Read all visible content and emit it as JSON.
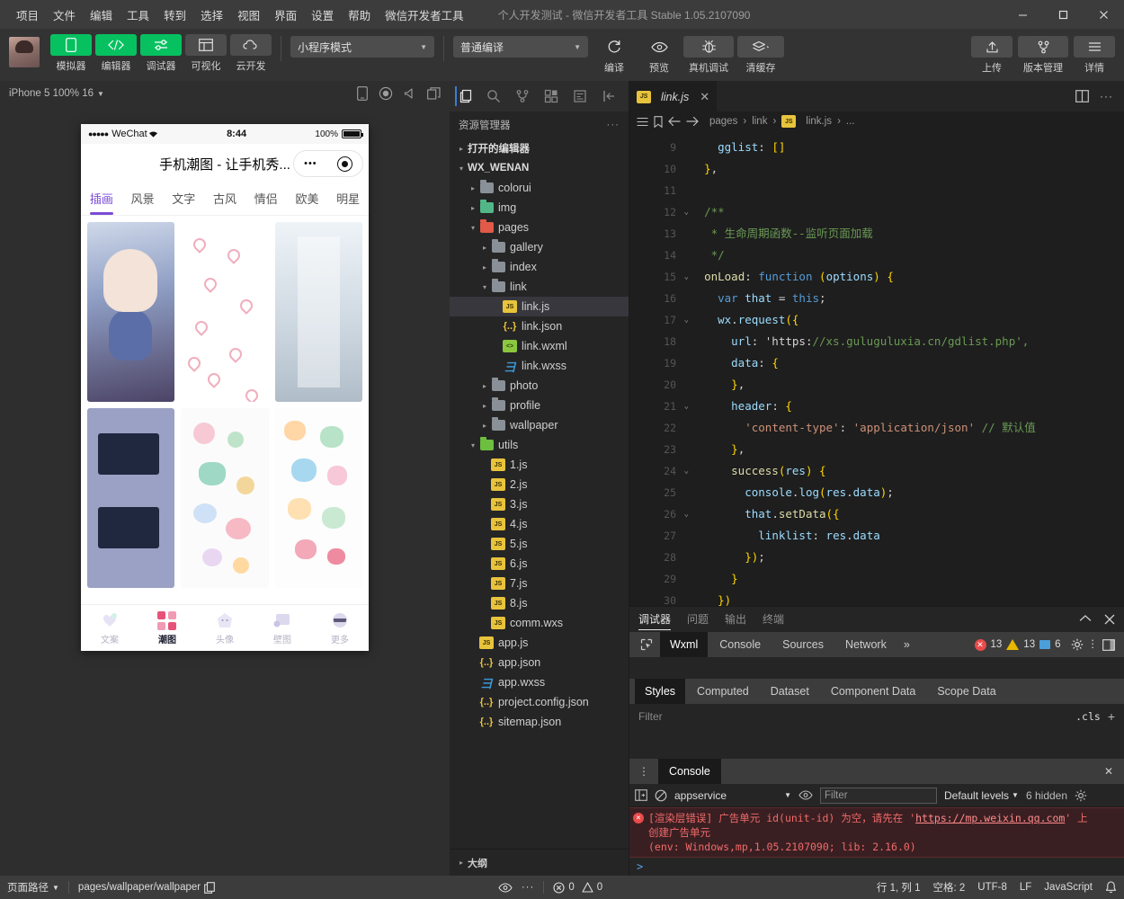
{
  "window": {
    "menus": [
      "项目",
      "文件",
      "编辑",
      "工具",
      "转到",
      "选择",
      "视图",
      "界面",
      "设置",
      "帮助",
      "微信开发者工具"
    ],
    "title": "个人开发测试 - 微信开发者工具 Stable 1.05.2107090",
    "minimize": "—",
    "maximize": "▢",
    "close": "✕"
  },
  "toolbar": {
    "left_buttons": [
      {
        "label": "模拟器",
        "icon": "phone-icon",
        "state": "active"
      },
      {
        "label": "编辑器",
        "icon": "code-icon",
        "state": "active"
      },
      {
        "label": "调试器",
        "icon": "debug-icon",
        "state": "active"
      },
      {
        "label": "可视化",
        "icon": "layout-icon",
        "state": "inactive"
      },
      {
        "label": "云开发",
        "icon": "cloud-icon",
        "state": "inactive"
      }
    ],
    "mode_select": "小程序模式",
    "compile_select": "普通编译",
    "actions": [
      {
        "label": "编译",
        "icon": "refresh-icon"
      },
      {
        "label": "预览",
        "icon": "eye-icon"
      },
      {
        "label": "真机调试",
        "icon": "bug-icon"
      },
      {
        "label": "清缓存",
        "icon": "layers-icon"
      }
    ],
    "right_actions": [
      {
        "label": "上传",
        "icon": "upload-icon"
      },
      {
        "label": "版本管理",
        "icon": "git-branch-icon"
      },
      {
        "label": "详情",
        "icon": "hamburger-icon"
      }
    ]
  },
  "simulator": {
    "device_label": "iPhone 5 100% 16",
    "icons": [
      "phone-rotate-icon",
      "record-icon",
      "volume-icon",
      "window-icon"
    ],
    "phone": {
      "status": {
        "carrier": "WeChat",
        "dots": "●●●●●",
        "wifi": "≈",
        "time": "8:44",
        "battery": "100%"
      },
      "nav_title": "手机潮图 - 让手机秀...",
      "capsule": {
        "more": "•••",
        "target": "◉"
      },
      "tabs": [
        "插画",
        "风景",
        "文字",
        "古风",
        "情侣",
        "欧美",
        "明星"
      ],
      "active_tab": "插画",
      "tabbar": [
        {
          "label": "文案",
          "icon": "balloon-icon",
          "active": false
        },
        {
          "label": "潮图",
          "icon": "grid-icon",
          "active": true
        },
        {
          "label": "头像",
          "icon": "ghost-icon",
          "active": false
        },
        {
          "label": "壁图",
          "icon": "frame-icon",
          "active": false
        },
        {
          "label": "更多",
          "icon": "smiley-icon",
          "active": false
        }
      ]
    }
  },
  "explorer": {
    "activity_icons": [
      "files-icon",
      "search-icon",
      "source-control-icon",
      "extensions-icon",
      "snippets-icon",
      "collapse-icon"
    ],
    "title": "资源管理器",
    "more": "···",
    "tree": [
      {
        "label": "打开的编辑器",
        "depth": 0,
        "type": "section",
        "twisty": "▸"
      },
      {
        "label": "WX_WENAN",
        "depth": 0,
        "type": "root",
        "twisty": "▾"
      },
      {
        "label": "colorui",
        "depth": 1,
        "type": "folder",
        "twisty": "▸",
        "color": "gray"
      },
      {
        "label": "img",
        "depth": 1,
        "type": "folder",
        "twisty": "▸",
        "color": "green"
      },
      {
        "label": "pages",
        "depth": 1,
        "type": "folder",
        "twisty": "▾",
        "color": "red"
      },
      {
        "label": "gallery",
        "depth": 2,
        "type": "folder",
        "twisty": "▸",
        "color": "gray"
      },
      {
        "label": "index",
        "depth": 2,
        "type": "folder",
        "twisty": "▸",
        "color": "gray"
      },
      {
        "label": "link",
        "depth": 2,
        "type": "folder",
        "twisty": "▾",
        "color": "gray"
      },
      {
        "label": "link.js",
        "depth": 3,
        "type": "js",
        "selected": true
      },
      {
        "label": "link.json",
        "depth": 3,
        "type": "json"
      },
      {
        "label": "link.wxml",
        "depth": 3,
        "type": "wxml"
      },
      {
        "label": "link.wxss",
        "depth": 3,
        "type": "wxss"
      },
      {
        "label": "photo",
        "depth": 2,
        "type": "folder",
        "twisty": "▸",
        "color": "gray"
      },
      {
        "label": "profile",
        "depth": 2,
        "type": "folder",
        "twisty": "▸",
        "color": "gray"
      },
      {
        "label": "wallpaper",
        "depth": 2,
        "type": "folder",
        "twisty": "▸",
        "color": "gray"
      },
      {
        "label": "utils",
        "depth": 1,
        "type": "folder",
        "twisty": "▾",
        "color": "lime"
      },
      {
        "label": "1.js",
        "depth": 2,
        "type": "js"
      },
      {
        "label": "2.js",
        "depth": 2,
        "type": "js"
      },
      {
        "label": "3.js",
        "depth": 2,
        "type": "js"
      },
      {
        "label": "4.js",
        "depth": 2,
        "type": "js"
      },
      {
        "label": "5.js",
        "depth": 2,
        "type": "js"
      },
      {
        "label": "6.js",
        "depth": 2,
        "type": "js"
      },
      {
        "label": "7.js",
        "depth": 2,
        "type": "js"
      },
      {
        "label": "8.js",
        "depth": 2,
        "type": "js"
      },
      {
        "label": "comm.wxs",
        "depth": 2,
        "type": "js"
      },
      {
        "label": "app.js",
        "depth": 1,
        "type": "js"
      },
      {
        "label": "app.json",
        "depth": 1,
        "type": "json"
      },
      {
        "label": "app.wxss",
        "depth": 1,
        "type": "wxss"
      },
      {
        "label": "project.config.json",
        "depth": 1,
        "type": "json"
      },
      {
        "label": "sitemap.json",
        "depth": 1,
        "type": "json"
      }
    ],
    "outline": {
      "label": "大纲",
      "twisty": "▸"
    }
  },
  "editor": {
    "tab": {
      "label": "link.js",
      "close": "✕"
    },
    "tab_right_icons": [
      "split-editor-icon",
      "more-actions-icon"
    ],
    "bread_icons": [
      "list-icon",
      "bookmark-icon",
      "back-icon",
      "forward-icon"
    ],
    "breadcrumb": [
      "pages",
      "link",
      "link.js",
      "..."
    ],
    "lines": [
      {
        "n": 9,
        "fold": "",
        "text": "    gglist: []"
      },
      {
        "n": 10,
        "fold": "",
        "text": "  },"
      },
      {
        "n": 11,
        "fold": "",
        "text": ""
      },
      {
        "n": 12,
        "fold": "⌄",
        "text": "  /**"
      },
      {
        "n": 13,
        "fold": "",
        "text": "   * 生命周期函数--监听页面加载"
      },
      {
        "n": 14,
        "fold": "",
        "text": "   */"
      },
      {
        "n": 15,
        "fold": "⌄",
        "text": "  onLoad: function (options) {"
      },
      {
        "n": 16,
        "fold": "",
        "text": "    var that = this;"
      },
      {
        "n": 17,
        "fold": "⌄",
        "text": "    wx.request({"
      },
      {
        "n": 18,
        "fold": "",
        "text": "      url: 'https://xs.guluguluxia.cn/gdlist.php',"
      },
      {
        "n": 19,
        "fold": "",
        "text": "      data: {"
      },
      {
        "n": 20,
        "fold": "",
        "text": "      },"
      },
      {
        "n": 21,
        "fold": "⌄",
        "text": "      header: {"
      },
      {
        "n": 22,
        "fold": "",
        "text": "        'content-type': 'application/json' // 默认值"
      },
      {
        "n": 23,
        "fold": "",
        "text": "      },"
      },
      {
        "n": 24,
        "fold": "⌄",
        "text": "      success(res) {"
      },
      {
        "n": 25,
        "fold": "",
        "text": "        console.log(res.data);"
      },
      {
        "n": 26,
        "fold": "⌄",
        "text": "        that.setData({"
      },
      {
        "n": 27,
        "fold": "",
        "text": "          linklist: res.data"
      },
      {
        "n": 28,
        "fold": "",
        "text": "        });"
      },
      {
        "n": 29,
        "fold": "",
        "text": "      }"
      },
      {
        "n": 30,
        "fold": "",
        "text": "    })"
      }
    ]
  },
  "debugger": {
    "panel_tabs": [
      "调试器",
      "问题",
      "输出",
      "终端"
    ],
    "panel_active": "调试器",
    "panel_icons": [
      "collapse-panel-icon",
      "close-panel-icon"
    ],
    "devtool_tabs": [
      "Wxml",
      "Console",
      "Sources",
      "Network"
    ],
    "devtool_active": "Wxml",
    "overflow": "»",
    "inspect_icon": "inspect-element-icon",
    "badges": {
      "errors": "13",
      "warnings": "13",
      "info": "6"
    },
    "badge_icons": [
      "settings-gear-icon",
      "more-vertical-icon",
      "dock-side-icon"
    ],
    "style_tabs": [
      "Styles",
      "Computed",
      "Dataset",
      "Component Data",
      "Scope Data"
    ],
    "style_active": "Styles",
    "filter_placeholder": "Filter",
    "cls_label": ".cls",
    "add_rule": "+",
    "console": {
      "title": "Console",
      "close": "✕",
      "context": "appservice",
      "filter_placeholder": "Filter",
      "levels": "Default levels",
      "hidden": "6 hidden",
      "icons": [
        "console-sidebar-icon",
        "clear-console-icon",
        "eye-icon",
        "settings-gear-icon"
      ],
      "error_line1_pre": "[渲染层错误] 广告单元 id(unit-id) 为空，请先在 '",
      "error_link": "https://mp.weixin.qq.com",
      "error_line1_post": "' 上",
      "error_line2": "创建广告单元",
      "error_line3": "(env: Windows,mp,1.05.2107090; lib: 2.16.0)",
      "prompt": ">"
    }
  },
  "statusbar": {
    "path_label": "页面路径",
    "path_value": "pages/wallpaper/wallpaper",
    "copy_icon": "copy-icon",
    "eye_icon": "eye-icon",
    "more": "···",
    "problems": {
      "errors": "0",
      "warnings": "0"
    },
    "cursor": "行 1, 列 1",
    "spaces": "空格: 2",
    "encoding": "UTF-8",
    "eol": "LF",
    "language": "JavaScript",
    "bell_icon": "bell-icon"
  },
  "colors": {
    "accent_green": "#07c160",
    "error_red": "#e94a4a",
    "warn_yellow": "#e6b800",
    "purple": "#7b4bd6"
  }
}
